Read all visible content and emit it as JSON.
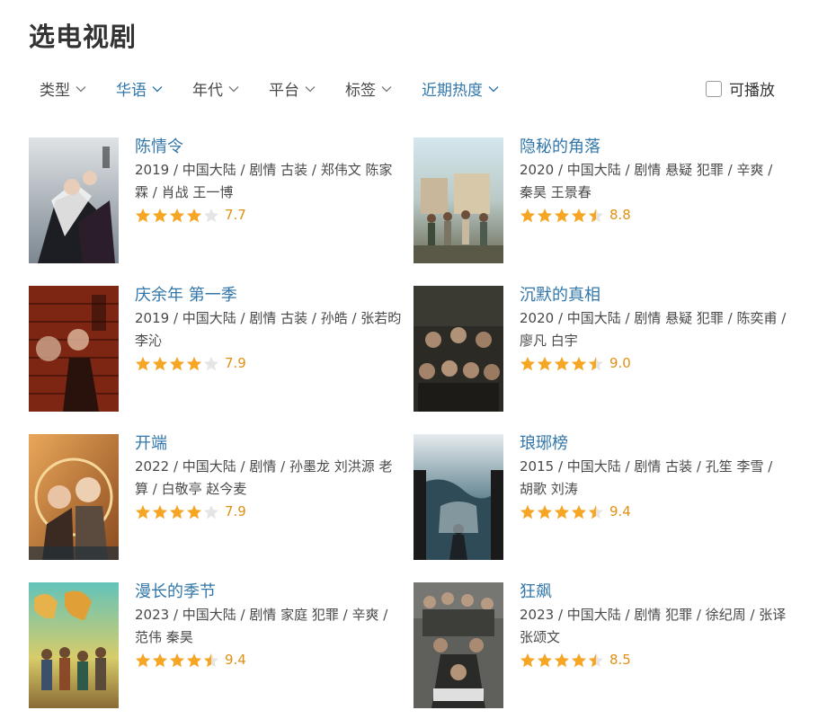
{
  "page": {
    "title": "选电视剧"
  },
  "filters": [
    {
      "label": "类型",
      "active": false
    },
    {
      "label": "华语",
      "active": true
    },
    {
      "label": "年代",
      "active": false
    },
    {
      "label": "平台",
      "active": false
    },
    {
      "label": "标签",
      "active": false
    },
    {
      "label": "近期热度",
      "active": true
    }
  ],
  "playable": {
    "label": "可播放",
    "checked": false
  },
  "colors": {
    "accent": "#3377aa",
    "star": "#f6a623",
    "star_empty": "#e5e5e5",
    "score": "#e09015"
  },
  "shows": [
    {
      "title": "陈情令",
      "meta": "2019 / 中国大陆 / 剧情 古装 / 郑伟文 陈家霖 / 肖战 王一博",
      "rating": 7.7,
      "stars": 4,
      "score": "7.7"
    },
    {
      "title": "隐秘的角落",
      "meta": "2020 / 中国大陆 / 剧情 悬疑 犯罪 / 辛爽 / 秦昊 王景春",
      "rating": 8.8,
      "stars": 4.5,
      "score": "8.8"
    },
    {
      "title": "庆余年 第一季",
      "meta": "2019 / 中国大陆 / 剧情 古装 / 孙皓 / 张若昀 李沁",
      "rating": 7.9,
      "stars": 4,
      "score": "7.9"
    },
    {
      "title": "沉默的真相",
      "meta": "2020 / 中国大陆 / 剧情 悬疑 犯罪 / 陈奕甫 / 廖凡 白宇",
      "rating": 9.0,
      "stars": 4.5,
      "score": "9.0"
    },
    {
      "title": "开端",
      "meta": "2022 / 中国大陆 / 剧情 / 孙墨龙 刘洪源 老算 / 白敬亭 赵今麦",
      "rating": 7.9,
      "stars": 4,
      "score": "7.9"
    },
    {
      "title": "琅琊榜",
      "meta": "2015 / 中国大陆 / 剧情 古装 / 孔笙 李雪 / 胡歌 刘涛",
      "rating": 9.4,
      "stars": 4.5,
      "score": "9.4"
    },
    {
      "title": "漫长的季节",
      "meta": "2023 / 中国大陆 / 剧情 家庭 犯罪 / 辛爽 / 范伟 秦昊",
      "rating": 9.4,
      "stars": 4.5,
      "score": "9.4"
    },
    {
      "title": "狂飙",
      "meta": "2023 / 中国大陆 / 剧情 犯罪 / 徐纪周 / 张译 张颂文",
      "rating": 8.5,
      "stars": 4.5,
      "score": "8.5"
    }
  ]
}
